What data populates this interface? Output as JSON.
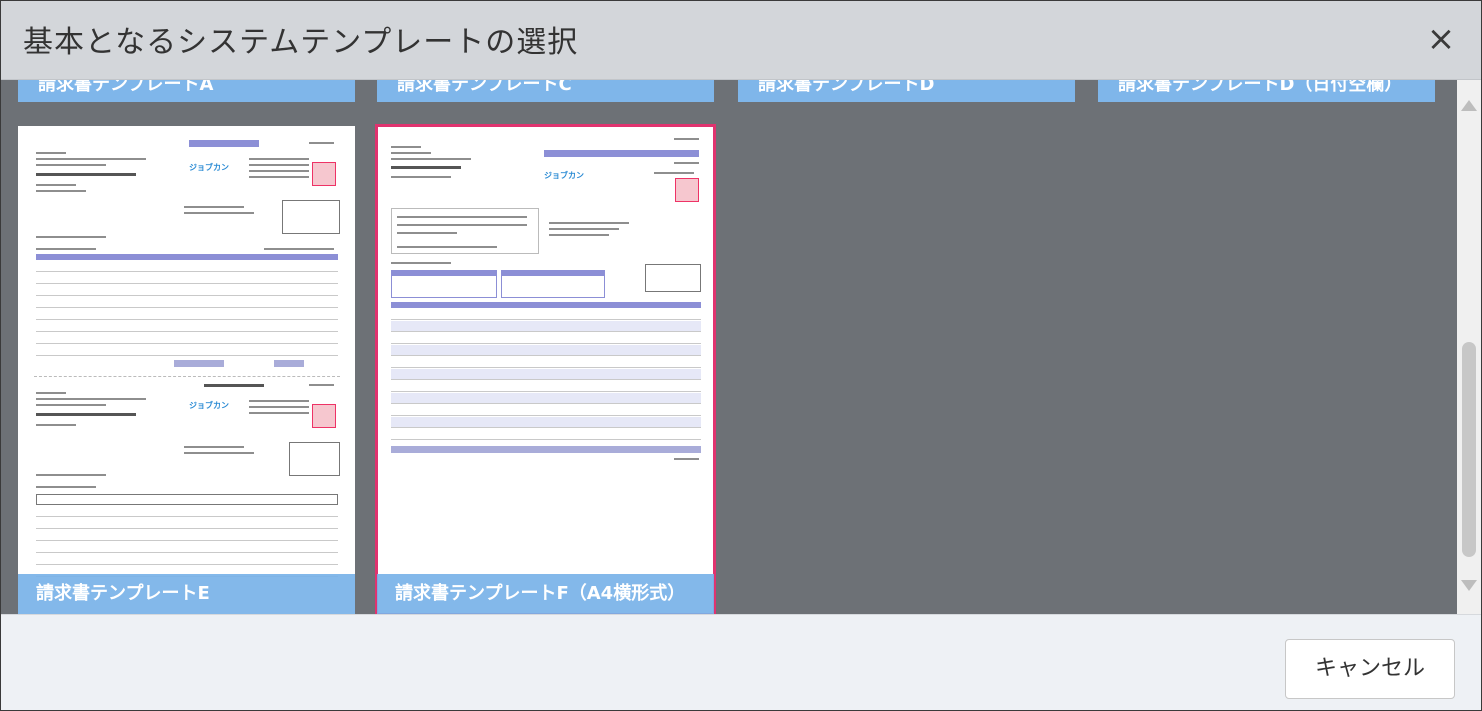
{
  "dialog": {
    "title": "基本となるシステムテンプレートの選択",
    "close_glyph": "×"
  },
  "templates_top_row": [
    {
      "label": "請求書テンプレートA"
    },
    {
      "label": "請求書テンプレートC"
    },
    {
      "label": "請求書テンプレートD"
    },
    {
      "label": "請求書テンプレートD（日付空欄）"
    }
  ],
  "templates": [
    {
      "label": "請求書テンプレートE",
      "selected": false
    },
    {
      "label": "請求書テンプレートF（A4横形式）",
      "selected": true
    }
  ],
  "footer": {
    "cancel_label": "キャンセル"
  },
  "colors": {
    "selected_border": "#e0336f",
    "label_bg": "#7fb6ea",
    "header_bg": "#d3d6da",
    "grid_bg": "#6d7176"
  }
}
